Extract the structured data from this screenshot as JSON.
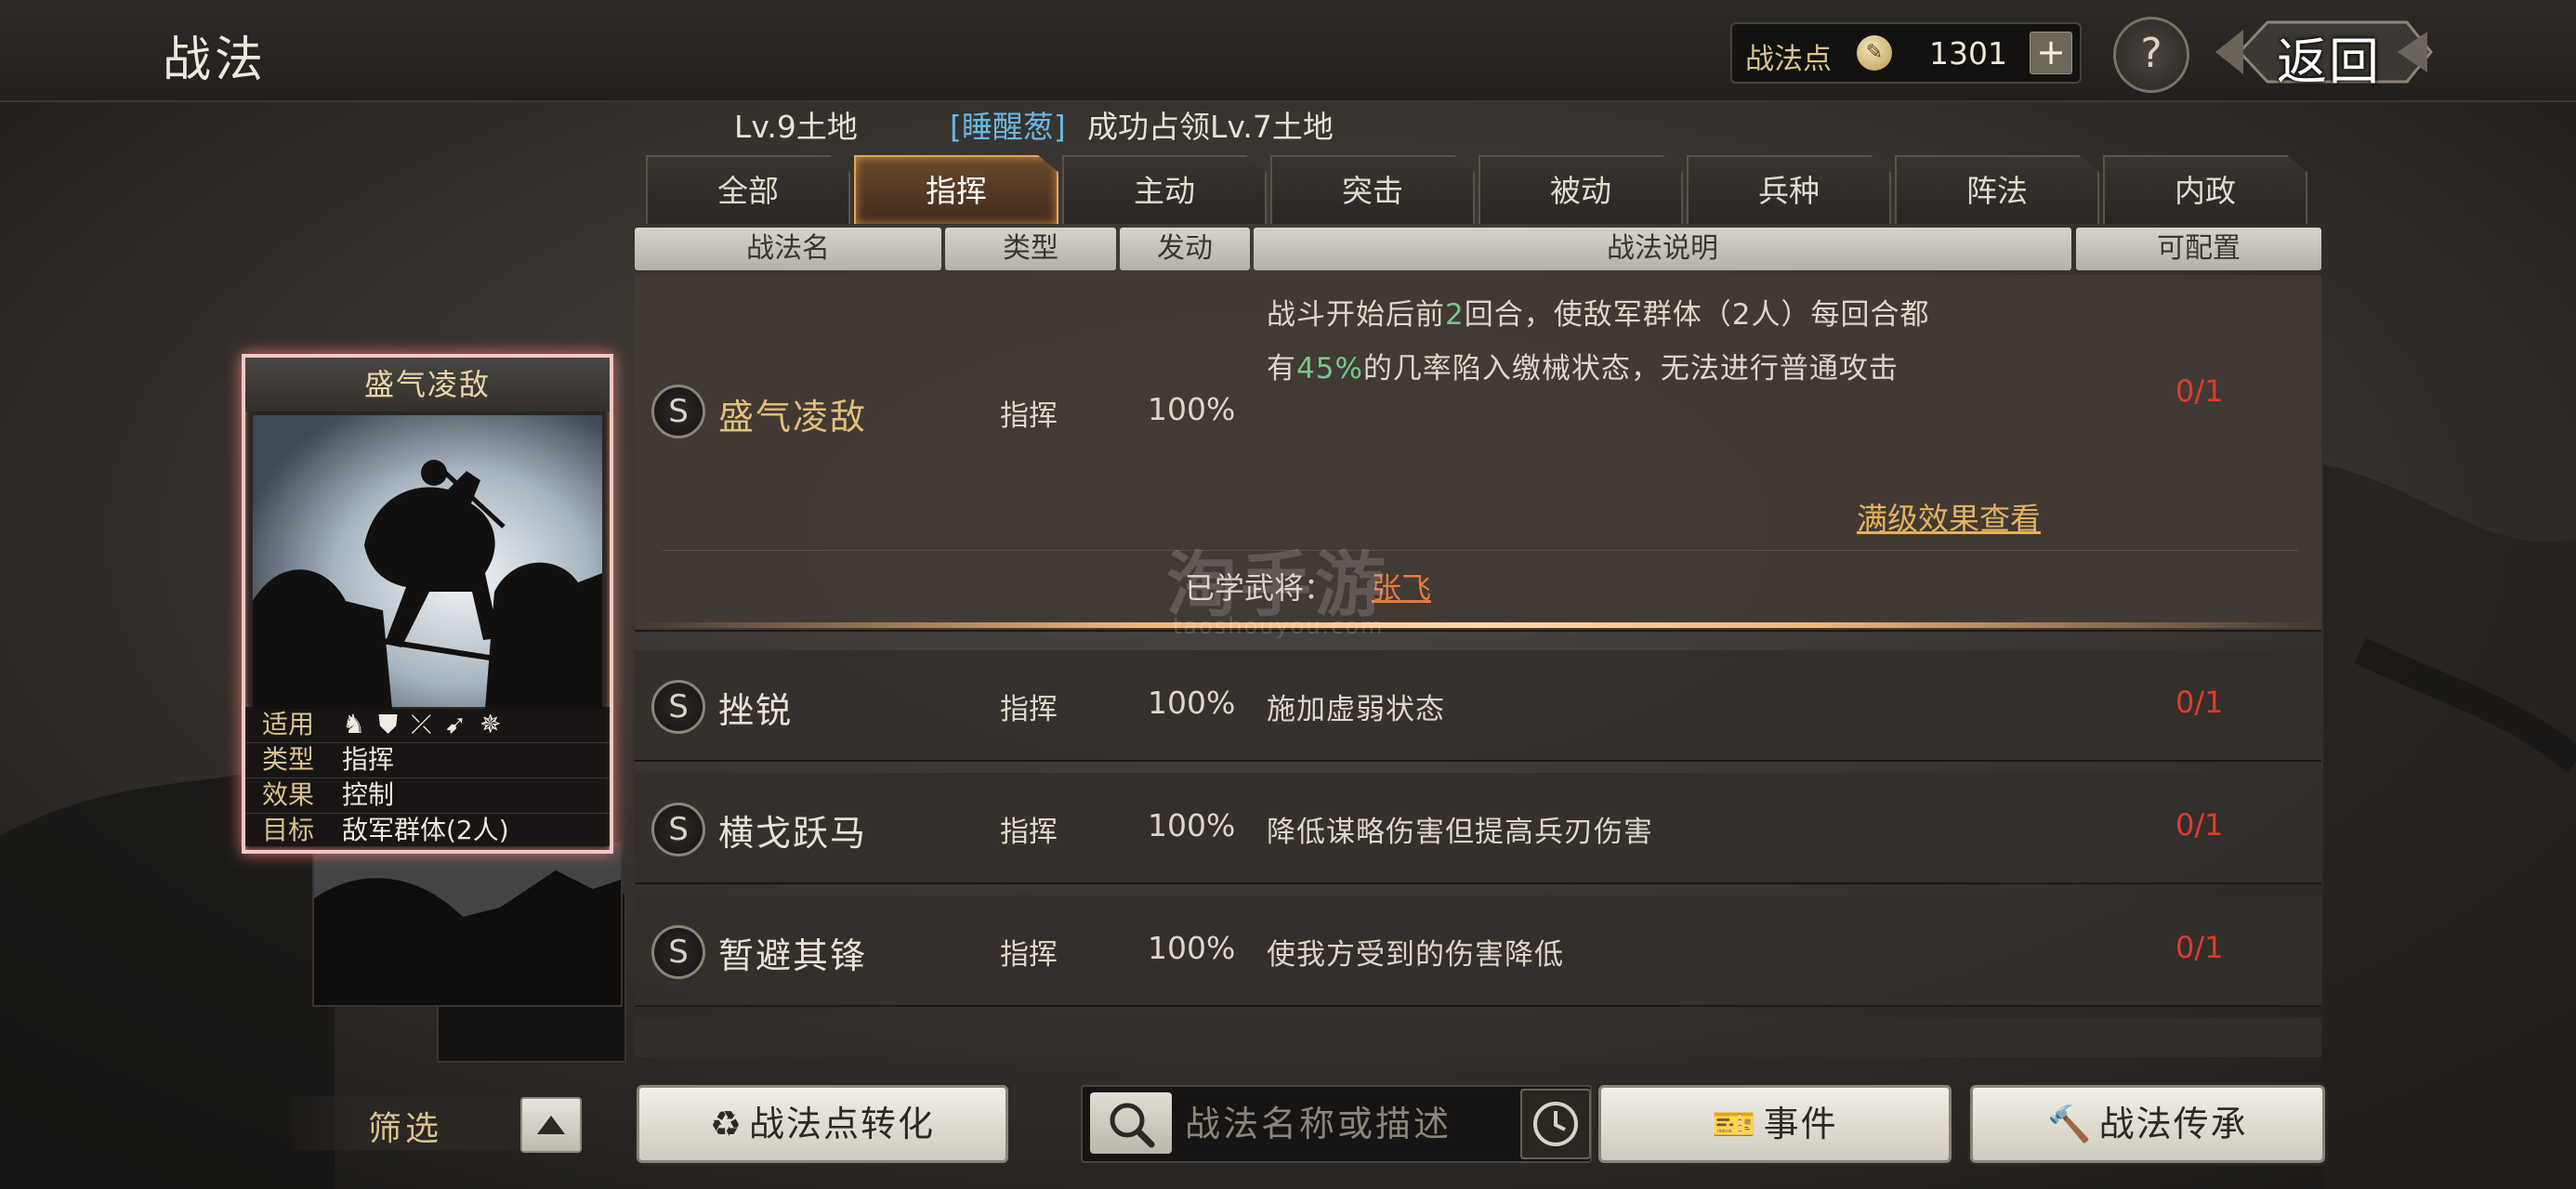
{
  "header": {
    "title": "战法",
    "points_label": "战法点",
    "points_value": "1301",
    "add_label": "+",
    "help_label": "?",
    "back_label": "返回"
  },
  "marquee": {
    "prev_text": "Lv.9土地",
    "player_name": "[睡醒葱]",
    "message": "成功占领Lv.7土地"
  },
  "tabs": [
    {
      "label": "全部",
      "active": false
    },
    {
      "label": "指挥",
      "active": true
    },
    {
      "label": "主动",
      "active": false
    },
    {
      "label": "突击",
      "active": false
    },
    {
      "label": "被动",
      "active": false
    },
    {
      "label": "兵种",
      "active": false
    },
    {
      "label": "阵法",
      "active": false
    },
    {
      "label": "内政",
      "active": false
    }
  ],
  "columns": {
    "name": "战法名",
    "type": "类型",
    "rate": "发动",
    "desc": "战法说明",
    "config": "可配置"
  },
  "rows": [
    {
      "grade": "S",
      "name": "盛气凌敌",
      "type": "指挥",
      "rate": "100%",
      "desc_line1_a": "战斗开始后前",
      "desc_line1_hl": "2",
      "desc_line1_b": "回合，使敌军群体（2人）每回合都",
      "desc_line2_a": "有",
      "desc_line2_hl": "45%",
      "desc_line2_b": "的几率陷入缴械状态，无法进行普通攻击",
      "config": "0/1",
      "max_link": "满级效果查看",
      "learned_label": "已学武将：",
      "learned_general": "张飞"
    },
    {
      "grade": "S",
      "name": "挫锐",
      "type": "指挥",
      "rate": "100%",
      "desc": "施加虚弱状态",
      "config": "0/1"
    },
    {
      "grade": "S",
      "name": "横戈跃马",
      "type": "指挥",
      "rate": "100%",
      "desc": "降低谋略伤害但提高兵刃伤害",
      "config": "0/1"
    },
    {
      "grade": "S",
      "name": "暂避其锋",
      "type": "指挥",
      "rate": "100%",
      "desc": "使我方受到的伤害降低",
      "config": "0/1"
    }
  ],
  "watermark": {
    "text": "淘手游",
    "sub": "taoshouyou.com"
  },
  "card": {
    "title": "盛气凌敌",
    "suitable_label": "适用",
    "suitable_icons": [
      "cavalry-icon",
      "shield-icon",
      "bow-icon",
      "spear-icon",
      "chariot-icon"
    ],
    "type_label": "类型",
    "type_value": "指挥",
    "effect_label": "效果",
    "effect_value": "控制",
    "target_label": "目标",
    "target_value": "敌军群体(2人)"
  },
  "bottom": {
    "filter_label": "筛选",
    "convert_label": "战法点转化",
    "search_placeholder": "战法名称或描述",
    "event_label": "事件",
    "inherit_label": "战法传承"
  },
  "colors": {
    "accent_gold": "#e0bf7a",
    "config_red": "#e03a2e",
    "highlight_green": "#74c98b",
    "player_blue": "#67b8e3"
  }
}
